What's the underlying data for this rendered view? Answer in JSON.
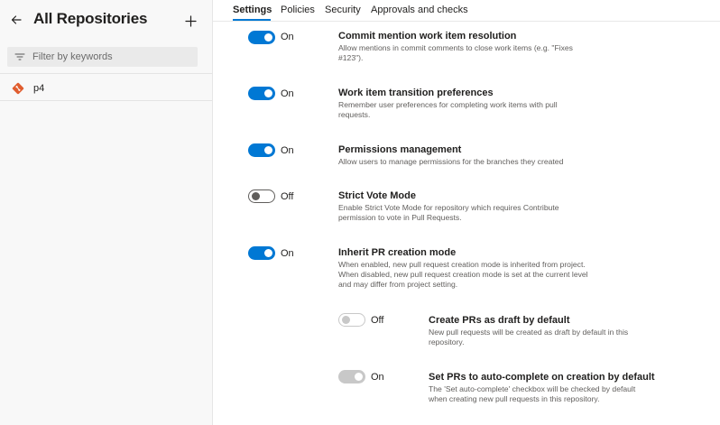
{
  "sidebar": {
    "title": "All Repositories",
    "filter_placeholder": "Filter by keywords",
    "repos": [
      {
        "label": "p4"
      }
    ]
  },
  "tabs": [
    {
      "label": "Settings",
      "active": true
    },
    {
      "label": "Policies",
      "active": false
    },
    {
      "label": "Security",
      "active": false
    },
    {
      "label": "Approvals and checks",
      "active": false
    }
  ],
  "settings": [
    {
      "title": "Commit mention work item resolution",
      "state": "On",
      "description": "Allow mentions in commit comments to close work items (e.g. \"Fixes #123\")."
    },
    {
      "title": "Work item transition preferences",
      "state": "On",
      "description": "Remember user preferences for completing work items with pull requests."
    },
    {
      "title": "Permissions management",
      "state": "On",
      "description": "Allow users to manage permissions for the branches they created"
    },
    {
      "title": "Strict Vote Mode",
      "state": "Off",
      "description": "Enable Strict Vote Mode for repository which requires Contribute permission to vote in Pull Requests."
    },
    {
      "title": "Inherit PR creation mode",
      "state": "On",
      "description": "When enabled, new pull request creation mode is inherited from project. When disabled, new pull request creation mode is set at the current level and may differ from project setting."
    },
    {
      "title": "Create PRs as draft by default",
      "state": "Off",
      "description": "New pull requests will be created as draft by default in this repository."
    },
    {
      "title": "Set PRs to auto-complete on creation by default",
      "state": "On",
      "description": "The 'Set auto-complete' checkbox will be checked by default when creating new pull requests in this repository."
    }
  ],
  "colors": {
    "accent": "#0078d4",
    "repo_icon": "#e05d2f"
  },
  "icons": {
    "back": "arrow-left-icon",
    "add": "plus-icon",
    "filter": "filter-icon",
    "repo": "git-repo-icon"
  }
}
